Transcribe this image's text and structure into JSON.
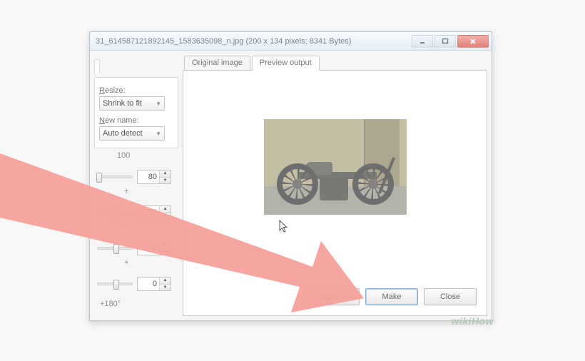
{
  "window": {
    "title": "31_614587121892145_1583635098_n.jpg  (200 x 134 pixels;  8341 Bytes)",
    "controls": {
      "min": "minimize",
      "max": "maximize",
      "close": "close"
    }
  },
  "sidebar": {
    "resize_label": "Resize:",
    "resize_value": "Shrink to fit",
    "newname_label": "New name:",
    "newname_prefix": "N",
    "newname_value": "Auto detect",
    "spinner_top_header": "100",
    "spin1": "80",
    "plus1": "+",
    "spin2": "0",
    "plus2": "+",
    "spin3": "0",
    "plus3": "+",
    "spin4": "0",
    "rotation_label": "+180°"
  },
  "tabs": {
    "original": "Original image",
    "preview": "Preview output"
  },
  "buttons": {
    "make_all": "Make All",
    "make": "Make",
    "close": "Close"
  },
  "watermark": "wikiHow"
}
